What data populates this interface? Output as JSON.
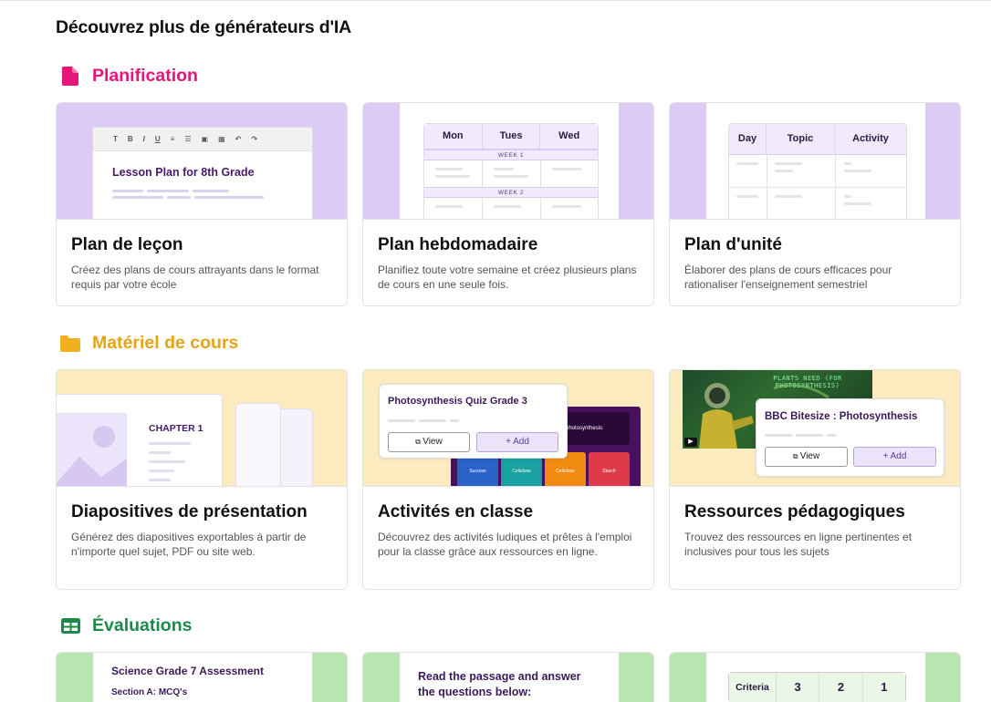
{
  "page": {
    "heading": "Découvrez plus de générateurs d'IA"
  },
  "colors": {
    "planning": "#e6157a",
    "materials": "#e8a317",
    "evaluations": "#1e8a4a",
    "preview_purple": "#dcccf5",
    "preview_yellow": "#fdebc0",
    "preview_green": "#b8e6b0"
  },
  "sections": {
    "planning": {
      "title": "Planification",
      "icon": "document-icon",
      "cards": [
        {
          "title": "Plan de leçon",
          "description": "Créez des plans de cours attrayants dans le format requis par votre école",
          "preview": {
            "toolbar": [
              "T",
              "B",
              "I",
              "U",
              "≡",
              "☰",
              "▣",
              "▦",
              "↶",
              "↷"
            ],
            "doc_title": "Lesson Plan for 8th Grade"
          }
        },
        {
          "title": "Plan hebdomadaire",
          "description": "Planifiez toute votre semaine et créez plusieurs plans de cours en une seule fois.",
          "preview": {
            "columns": [
              "Mon",
              "Tues",
              "Wed"
            ],
            "week1": "WEEK 1",
            "week2": "WEEK 2"
          }
        },
        {
          "title": "Plan d'unité",
          "description": "Élaborer des plans de cours efficaces pour rationaliser l'enseignement semestriel",
          "preview": {
            "columns": [
              "Day",
              "Topic",
              "Activity"
            ]
          }
        }
      ]
    },
    "materials": {
      "title": "Matériel de cours",
      "icon": "folder-icon",
      "cards": [
        {
          "title": "Diapositives de présentation",
          "description": "Générez des diapositives exportables à partir de n'importe quel sujet, PDF ou site web.",
          "preview": {
            "chapter": "CHAPTER 1"
          }
        },
        {
          "title": "Activités en classe",
          "description": "Découvrez des activités ludiques et prêtes à l'emploi pour la classe grâce aux ressources en ligne.",
          "preview": {
            "quiz_title": "Photosynthesis Quiz Grade 3",
            "view": "View",
            "add": "+ Add",
            "screen_text": "photosynthesis:",
            "tiles": [
              "Sucrose",
              "Cellulose",
              "Cellulose",
              "Starch"
            ]
          }
        },
        {
          "title": "Ressources pédagogiques",
          "description": "Trouvez des ressources en ligne pertinentes et inclusives pour tous les sujets",
          "preview": {
            "video_caption": "PLANTS NEED (FOR PHOTOSYNTHESIS)",
            "resource_title": "BBC Bitesize : Photosynthesis",
            "view": "View",
            "add": "+ Add"
          }
        }
      ]
    },
    "evaluations": {
      "title": "Évaluations",
      "icon": "table-icon",
      "cards": [
        {
          "preview": {
            "title": "Science Grade 7 Assessment",
            "subtitle": "Section A: MCQ's"
          }
        },
        {
          "preview": {
            "title": "Read the passage and answer the questions below:"
          }
        },
        {
          "preview": {
            "label": "Criteria",
            "scores": [
              "3",
              "2",
              "1"
            ]
          }
        }
      ]
    }
  }
}
